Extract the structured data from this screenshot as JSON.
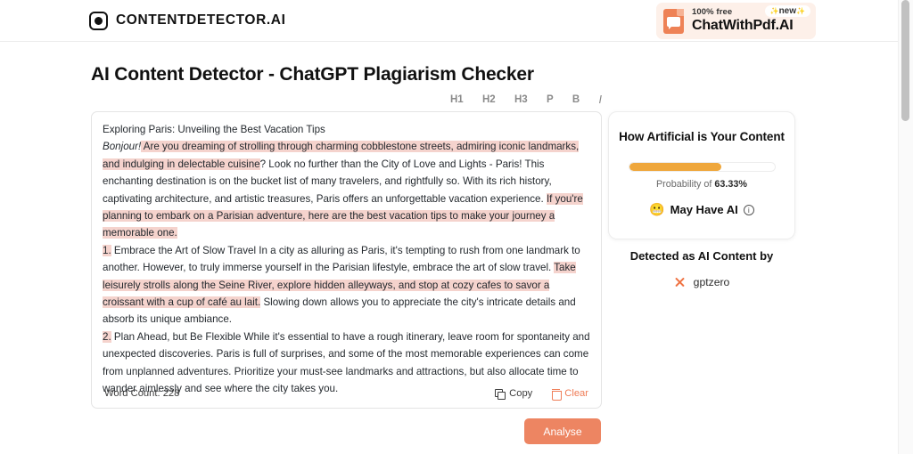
{
  "header": {
    "brand_name": "CONTENTDETECTOR.AI",
    "ad": {
      "free_label": "100% free",
      "title": "ChatWithPdf.AI",
      "badge": "new",
      "badge_spark_left": "✨",
      "badge_spark_right": "✨"
    }
  },
  "page_title": "AI Content Detector - ChatGPT Plagiarism Checker",
  "format_bar": {
    "items": [
      "H1",
      "H2",
      "H3",
      "P",
      "B",
      "I"
    ]
  },
  "editor": {
    "line_1": "Exploring Paris: Unveiling the Best Vacation Tips",
    "para_2": {
      "italic_lead": "Bonjour!",
      "highlight_1": " Are you dreaming of strolling through charming cobblestone streets, admiring iconic landmarks, and indulging in delectable cuisine",
      "plain_1": "? Look no further than the City of Love and Lights - Paris! This enchanting destination is on the bucket list of many travelers, and rightfully so. With its rich history, captivating architecture, and artistic treasures, Paris offers an unforgettable vacation experience. ",
      "highlight_2": "If you're planning to embark on a Parisian adventure, here are the best vacation tips to make your journey a memorable one."
    },
    "para_3": {
      "highlight_number": "1.",
      "plain_1": " Embrace the Art of Slow Travel In a city as alluring as Paris, it's tempting to rush from one landmark to another. However, to truly immerse yourself in the Parisian lifestyle, embrace the art of slow travel. ",
      "highlight_1": "Take leisurely strolls along the Seine River, explore hidden alleyways, and stop at cozy cafes to savor a croissant with a cup of café au lait.",
      "plain_2": " Slowing down allows you to appreciate the city's intricate details and absorb its unique ambiance."
    },
    "para_4": {
      "highlight_number": "2.",
      "plain_1": " Plan Ahead, but Be Flexible While it's essential to have a rough itinerary, leave room for spontaneity and unexpected discoveries. Paris is full of surprises, and some of the most memorable experiences can come from unplanned adventures. Prioritize your must-see landmarks and attractions, but also allocate time to wander aimlessly and see where the city takes you."
    },
    "word_count_label": "Word Count: 228",
    "copy_label": "Copy",
    "clear_label": "Clear"
  },
  "result": {
    "title": "How Artificial is Your Content",
    "progress_percent": 63.33,
    "probability_prefix": "Probability of ",
    "probability_value": "63.33%",
    "verdict_emoji": "😬",
    "verdict_label": "May Have AI",
    "info_glyph": "i",
    "detected_title": "Detected as AI Content by",
    "detectors": [
      {
        "name": "gptzero",
        "status_icon": "x-icon"
      }
    ]
  },
  "analyse_button_label": "Analyse",
  "colors": {
    "accent_orange": "#ed8562",
    "progress_orange": "#efa73c",
    "highlight_pink": "#f5d3cd",
    "ad_background": "#fdf0e9"
  }
}
